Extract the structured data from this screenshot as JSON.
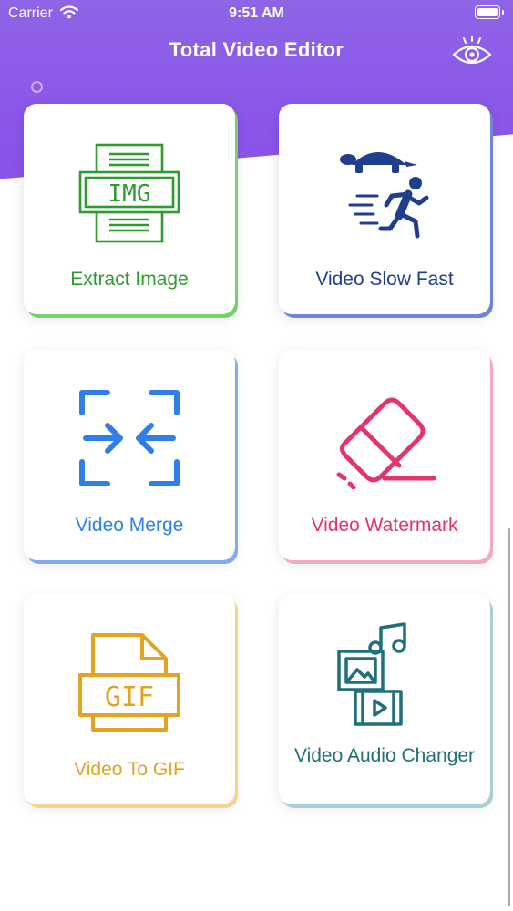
{
  "status_bar": {
    "carrier": "Carrier",
    "time": "9:51 AM"
  },
  "header": {
    "title": "Total Video Editor",
    "eye_icon": "eye-icon"
  },
  "tools": [
    {
      "label": "Extract Image",
      "color": "#2e9b2e",
      "icon": "img-document-icon",
      "icon_text": "IMG"
    },
    {
      "label": "Video Slow Fast",
      "color": "#1f3f8c",
      "icon": "turtle-runner-icon"
    },
    {
      "label": "Video Merge",
      "color": "#2f7fe8",
      "icon": "merge-arrows-icon"
    },
    {
      "label": "Video Watermark",
      "color": "#e4346e",
      "icon": "eraser-icon"
    },
    {
      "label": "Video To GIF",
      "color": "#e3a320",
      "icon": "gif-file-icon",
      "icon_text": "GIF"
    },
    {
      "label": "Video Audio Changer",
      "color": "#1f6f7c",
      "icon": "video-audio-icon"
    }
  ],
  "colors": {
    "header_gradient_start": "#8f64e6",
    "header_gradient_end": "#8b4fea"
  }
}
